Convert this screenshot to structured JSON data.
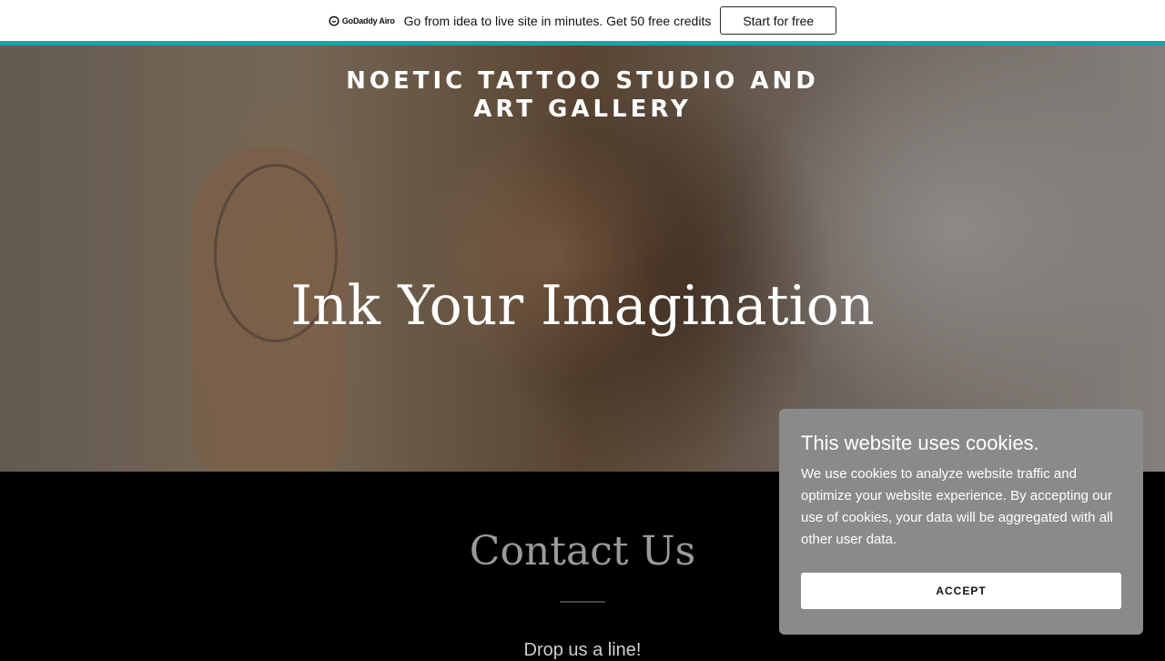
{
  "promo_bar": {
    "logo_text": "GoDaddy Airo",
    "message": "Go from idea to live site in minutes. Get 50 free credits",
    "cta_label": "Start for free",
    "accent_color": "#1aa3a9"
  },
  "hero": {
    "site_title_line1": "NOETIC TATTOO STUDIO AND",
    "site_title_line2": "ART GALLERY",
    "heading": "Ink Your Imagination"
  },
  "contact": {
    "title": "Contact Us",
    "subtitle": "Drop us a line!"
  },
  "cookie_banner": {
    "title": "This website uses cookies.",
    "body": "We use cookies to analyze website traffic and optimize your website experience. By accepting our use of cookies, your data will be aggregated with all other user data.",
    "accept_label": "ACCEPT",
    "background_color": "#8a8a8a"
  }
}
